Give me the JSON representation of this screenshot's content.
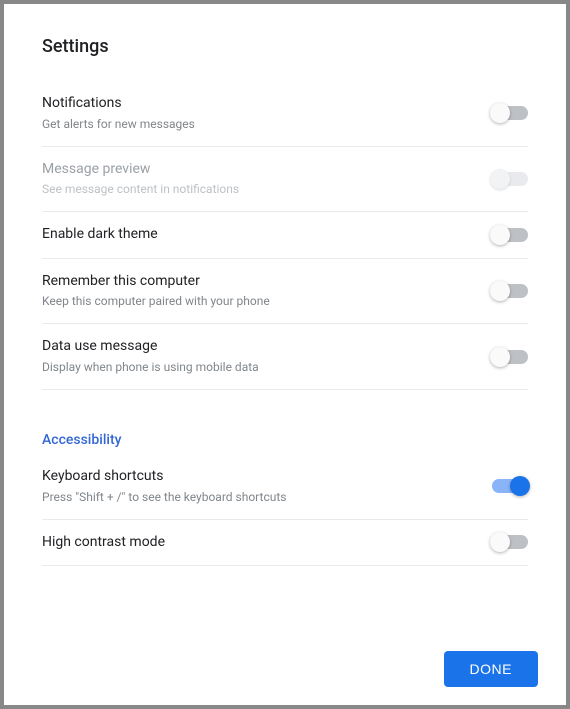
{
  "dialog": {
    "title": "Settings",
    "done_label": "DONE"
  },
  "sections": {
    "accessibility_header": "Accessibility"
  },
  "settings": {
    "notifications": {
      "label": "Notifications",
      "desc": "Get alerts for new messages"
    },
    "message_preview": {
      "label": "Message preview",
      "desc": "See message content in notifications"
    },
    "dark_theme": {
      "label": "Enable dark theme"
    },
    "remember_computer": {
      "label": "Remember this computer",
      "desc": "Keep this computer paired with your phone"
    },
    "data_use": {
      "label": "Data use message",
      "desc": "Display when phone is using mobile data"
    },
    "keyboard_shortcuts": {
      "label": "Keyboard shortcuts",
      "desc": "Press \"Shift + /\" to see the keyboard shortcuts"
    },
    "high_contrast": {
      "label": "High contrast mode"
    }
  }
}
